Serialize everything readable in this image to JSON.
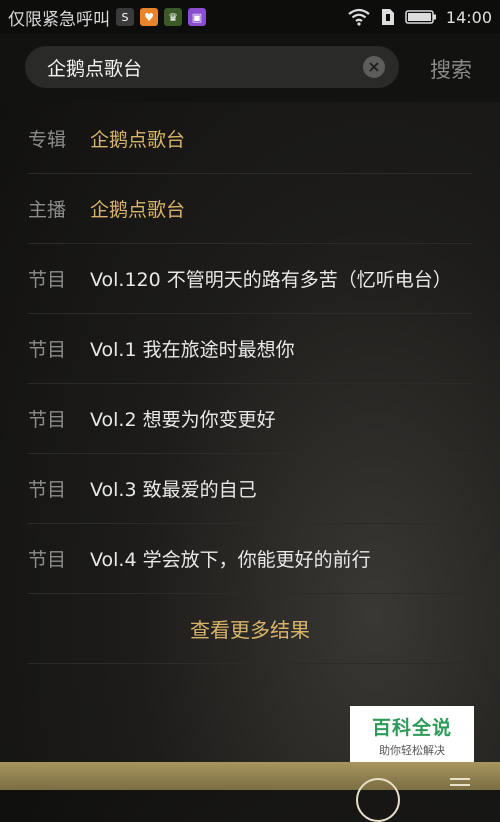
{
  "status_bar": {
    "carrier": "仅限紧急呼叫",
    "time": "14:00",
    "notification_icons": [
      {
        "name": "app-s-icon",
        "color": "#3a3a3a",
        "glyph": "S"
      },
      {
        "name": "app-orange-icon",
        "color": "#e8852a",
        "glyph": "♥"
      },
      {
        "name": "app-crown-icon",
        "color": "#3a5a2a",
        "glyph": "♛"
      },
      {
        "name": "app-purple-icon",
        "color": "#8a4fd0",
        "glyph": "▣"
      }
    ]
  },
  "search": {
    "query": "企鹅点歌台",
    "button_label": "搜索"
  },
  "results": [
    {
      "type": "专辑",
      "title": "企鹅点歌台",
      "highlight": true
    },
    {
      "type": "主播",
      "title": "企鹅点歌台",
      "highlight": true
    },
    {
      "type": "节目",
      "title": "Vol.120 不管明天的路有多苦（忆听电台）",
      "highlight": false
    },
    {
      "type": "节目",
      "title": "Vol.1 我在旅途时最想你",
      "highlight": false
    },
    {
      "type": "节目",
      "title": "Vol.2 想要为你变更好",
      "highlight": false
    },
    {
      "type": "节目",
      "title": "Vol.3 致最爱的自己",
      "highlight": false
    },
    {
      "type": "节目",
      "title": "Vol.4 学会放下，你能更好的前行",
      "highlight": false
    }
  ],
  "more_results_label": "查看更多结果",
  "watermark": {
    "title": "百科全说",
    "subtitle": "助你轻松解决"
  },
  "colors": {
    "accent_gold": "#d7b46a",
    "watermark_green": "#2e9a5a"
  }
}
